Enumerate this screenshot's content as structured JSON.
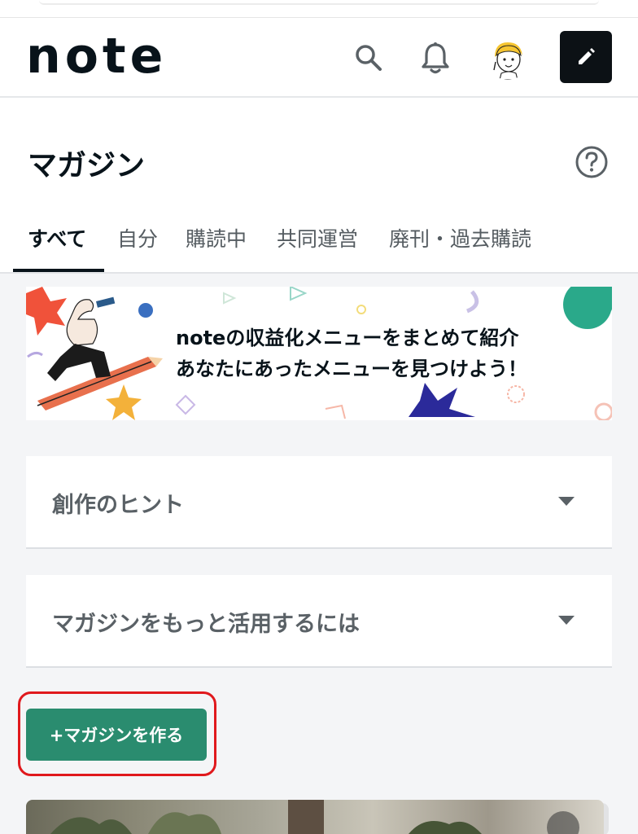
{
  "header": {
    "logo_text": "note",
    "icons": [
      "search-icon",
      "bell-icon",
      "avatar",
      "pencil-icon"
    ]
  },
  "page": {
    "title": "マガジン"
  },
  "tabs": [
    {
      "label": "すべて",
      "active": true
    },
    {
      "label": "自分",
      "active": false
    },
    {
      "label": "購読中",
      "active": false
    },
    {
      "label": "共同運営",
      "active": false
    },
    {
      "label": "廃刊・過去購読",
      "active": false
    }
  ],
  "banner": {
    "line1": "noteの収益化メニューをまとめて紹介",
    "line2": "あなたにあったメニューを見つけよう！"
  },
  "accordions": [
    {
      "label": "創作のヒント"
    },
    {
      "label": "マガジンをもっと活用するには"
    }
  ],
  "create_button": {
    "label": "+マガジンを作る"
  },
  "colors": {
    "accent_green": "#2a8c6f",
    "highlight_red": "#e0191d",
    "text_dark": "#08131a"
  }
}
